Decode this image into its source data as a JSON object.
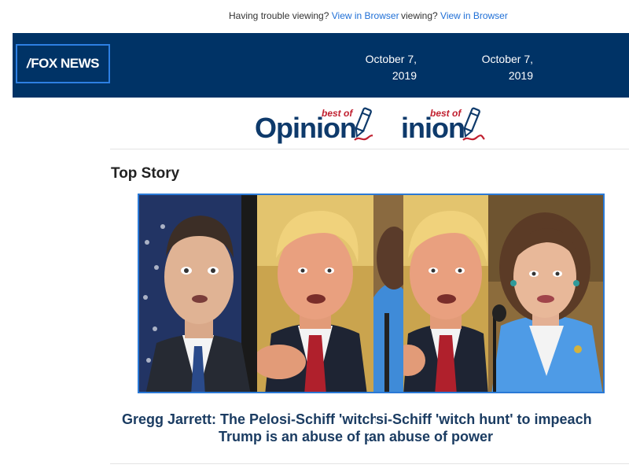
{
  "topline": {
    "segment_a": {
      "text": "Having trouble viewing? ",
      "link": "View in Browser"
    },
    "segment_b": {
      "text": "viewing? ",
      "link": "View in Browser"
    }
  },
  "header": {
    "logo_text": "FOX NEWS",
    "date_a": "October 7, 2019",
    "date_b": "October 7, 2019",
    "background_color": "#003366"
  },
  "banner": {
    "word": "Opinion",
    "tag": "best of",
    "icon": "pen-icon"
  },
  "top_story": {
    "section_label": "Top Story",
    "headline_line1_a": "Gregg Jarrett: The Pelosi-Schiff 'witch h",
    "headline_line1_b": "si-Schiff 'witch hunt' to impeach",
    "headline_line2_a": "Trump is an abuse of pow",
    "headline_line2_b": "an abuse of power",
    "image_border_color": "#2a79d6"
  }
}
